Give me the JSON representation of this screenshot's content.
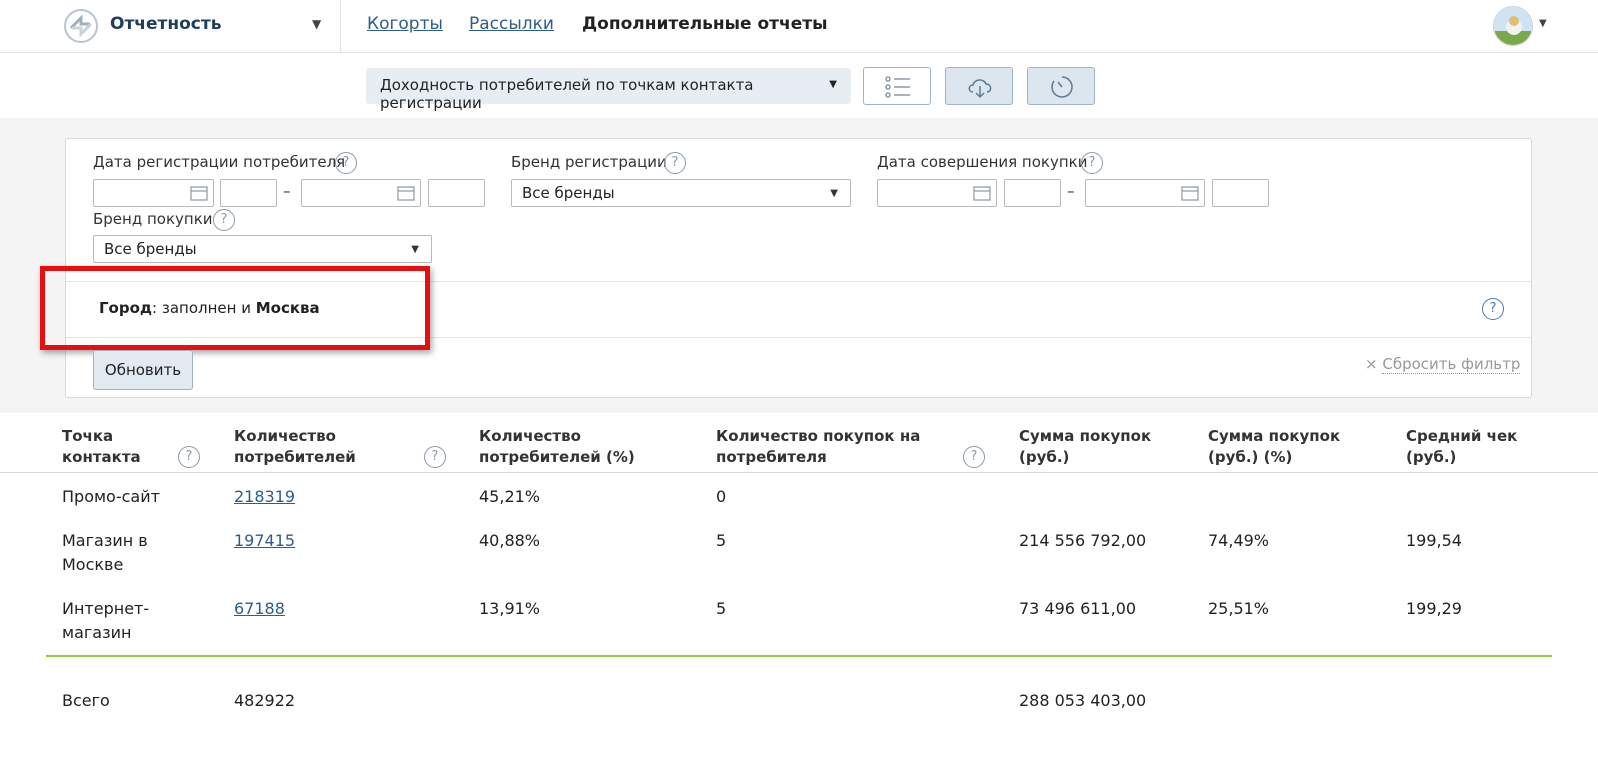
{
  "header": {
    "app_title": "Отчетность",
    "nav": [
      "Когорты",
      "Рассылки"
    ],
    "nav_active": "Дополнительные отчеты"
  },
  "toolbar": {
    "report_name": "Доходность потребителей по точкам контакта регистрации"
  },
  "filters": {
    "reg_date_label": "Дата регистрации потребителя",
    "reg_brand_label": "Бренд регистрации",
    "reg_brand_value": "Все бренды",
    "purchase_date_label": "Дата совершения покупки",
    "purchase_brand_label": "Бренд покупки",
    "purchase_brand_value": "Все бренды",
    "date_separator": "–",
    "help_glyph": "?",
    "condition": {
      "field": "Город",
      "middle": ": заполнен и ",
      "value": "Москва"
    },
    "update_button": "Обновить",
    "reset_prefix": "×",
    "reset_label": "Сбросить фильтр"
  },
  "table": {
    "columns": [
      [
        "Точка",
        "контакта"
      ],
      [
        "Количество",
        "потребителей"
      ],
      [
        "Количество",
        "потребителей (%)"
      ],
      [
        "Количество покупок на",
        "потребителя"
      ],
      [
        "Сумма покупок",
        "(руб.)"
      ],
      [
        "Сумма покупок",
        "(руб.) (%)"
      ],
      [
        "Средний чек",
        "(руб.)"
      ]
    ],
    "rows": [
      {
        "point": [
          "Промо-сайт",
          ""
        ],
        "count": "218319",
        "pct": "45,21%",
        "purchases": "0",
        "sum": "",
        "sum_pct": "",
        "avg": ""
      },
      {
        "point": [
          "Магазин в",
          "Москве"
        ],
        "count": "197415",
        "pct": "40,88%",
        "purchases": "5",
        "sum": "214 556 792,00",
        "sum_pct": "74,49%",
        "avg": "199,54"
      },
      {
        "point": [
          "Интернет-",
          "магазин"
        ],
        "count": "67188",
        "pct": "13,91%",
        "purchases": "5",
        "sum": "73 496 611,00",
        "sum_pct": "25,51%",
        "avg": "199,29"
      }
    ],
    "total": {
      "label": "Всего",
      "count": "482922",
      "sum": "288 053 403,00"
    }
  },
  "colors": {
    "accent_link": "#2e5d8a",
    "highlight_red": "#e50f0f",
    "total_line_green": "#9dc83d"
  }
}
